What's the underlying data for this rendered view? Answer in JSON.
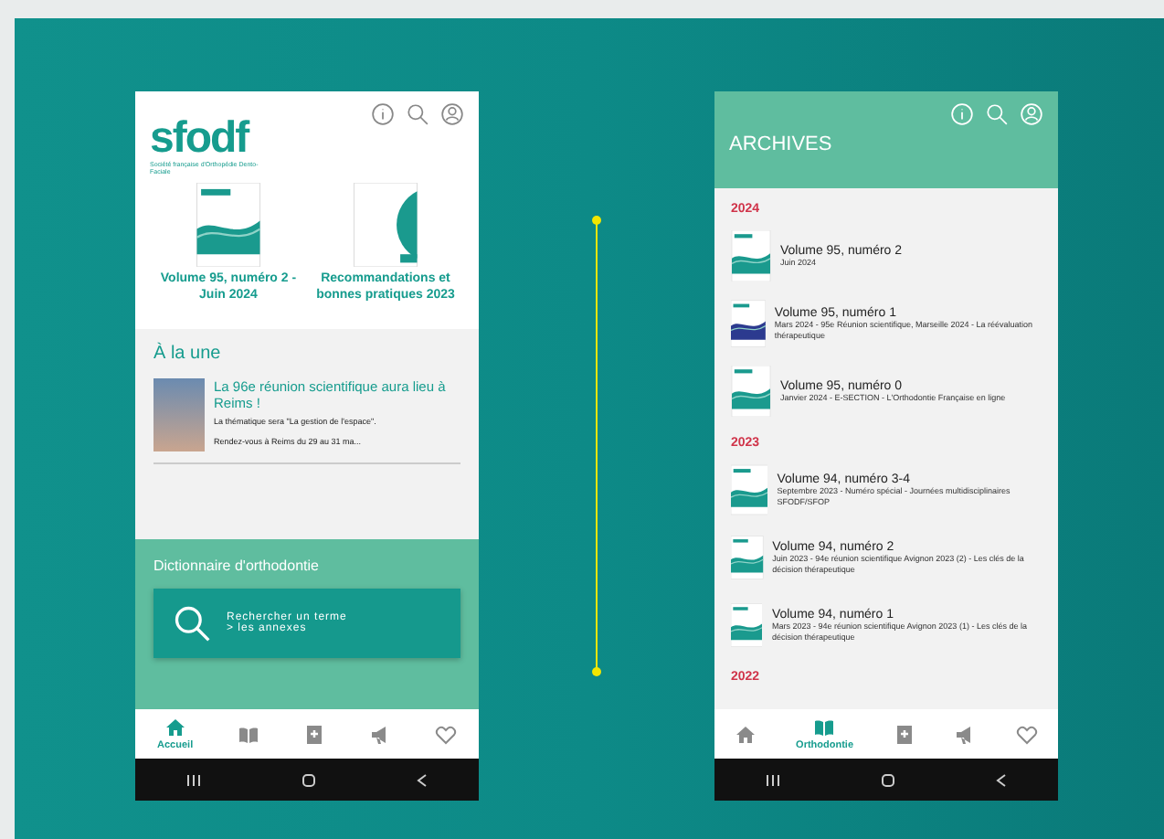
{
  "home_screen": {
    "logo": {
      "name": "sfodf",
      "subtitle": "Société française d'Orthopédie Dento-Faciale"
    },
    "publications": [
      {
        "title": "Volume 95, numéro 2 - Juin 2024"
      },
      {
        "title": "Recommandations et bonnes pratiques 2023"
      }
    ],
    "news": {
      "heading": "À la une",
      "items": [
        {
          "title": "La 96e réunion scientifique aura lieu à Reims !",
          "summary": "La thématique sera \"La gestion de l'espace\".",
          "teaser": "Rendez-vous à Reims du 29 au 31 ma..."
        }
      ]
    },
    "dictionary": {
      "heading": "Dictionnaire d'orthodontie",
      "search_lines": [
        "Rechercher un terme",
        "> les annexes"
      ]
    },
    "nav": [
      {
        "label": "Accueil",
        "selected": true
      },
      {
        "selected": false
      },
      {
        "selected": false
      },
      {
        "selected": false
      },
      {
        "selected": false
      }
    ]
  },
  "archives_screen": {
    "title": "ARCHIVES",
    "groups": [
      {
        "year": "2024",
        "issues": [
          {
            "title": "Volume 95, numéro 2",
            "details": "Juin 2024"
          },
          {
            "title": "Volume 95, numéro 1",
            "details": "Mars 2024 - 95e Réunion scientifique, Marseille 2024 - La réévaluation thérapeutique"
          },
          {
            "title": "Volume 95, numéro 0",
            "details": "Janvier 2024 - E-SECTION - L'Orthodontie Française en ligne"
          }
        ]
      },
      {
        "year": "2023",
        "issues": [
          {
            "title": "Volume 94, numéro 3-4",
            "details": "Septembre 2023 - Numéro spécial - Journées multidisciplinaires SFODF/SFOP"
          },
          {
            "title": "Volume 94, numéro 2",
            "details": "Juin 2023 - 94e réunion scientifique Avignon 2023 (2) - Les clés de la décision thérapeutique"
          },
          {
            "title": "Volume 94, numéro 1",
            "details": "Mars 2023 - 94e réunion scientifique Avignon 2023 (1) - Les clés de la décision thérapeutique"
          }
        ]
      },
      {
        "year": "2022"
      }
    ],
    "nav": [
      {
        "selected": false
      },
      {
        "label": "Orthodontie",
        "selected": true
      },
      {
        "selected": false
      },
      {
        "selected": false
      },
      {
        "selected": false
      }
    ]
  }
}
